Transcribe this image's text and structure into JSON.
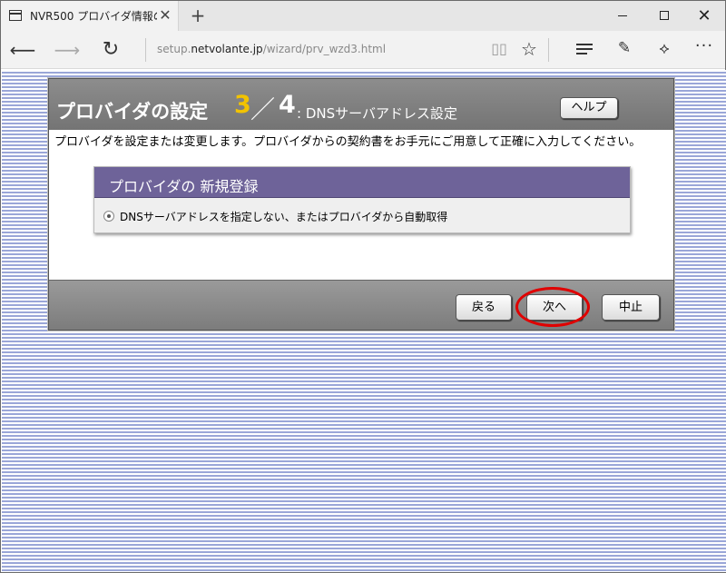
{
  "browser": {
    "tab_title": "NVR500 プロバイダ情報の",
    "tab_close": "✕",
    "new_tab": "+",
    "url_prefix": "setup.",
    "url_host": "netvolante.jp",
    "url_path": "/wizard/prv_wzd3.html",
    "icons": [
      "tab-page-icon",
      "back-arrow-icon",
      "forward-arrow-icon",
      "refresh-icon",
      "reading-view-icon",
      "favorite-star-icon",
      "hub-icon",
      "web-note-icon",
      "share-icon",
      "more-icon"
    ]
  },
  "dialog": {
    "title": "プロバイダの設定",
    "step_current": "3",
    "step_sep": "／",
    "step_total": "4",
    "subtitle": ": DNSサーバアドレス設定",
    "help_label": "ヘルプ",
    "intro": "プロバイダを設定または変更します。プロバイダからの契約書をお手元にご用意して正確に入力してください。",
    "registration": {
      "title": "プロバイダの 新規登録",
      "option_label": "DNSサーバアドレスを指定しない、またはプロバイダから自動取得",
      "option_selected": true
    },
    "footer": {
      "back_label": "戻る",
      "next_label": "次へ",
      "cancel_label": "中止"
    }
  },
  "colors": {
    "header_gray": "#7f7f7f",
    "step_yellow": "#f2c300",
    "registration_purple": "#6e6399",
    "highlight_red": "#e00000",
    "page_stripe": "#9aa6d8"
  }
}
